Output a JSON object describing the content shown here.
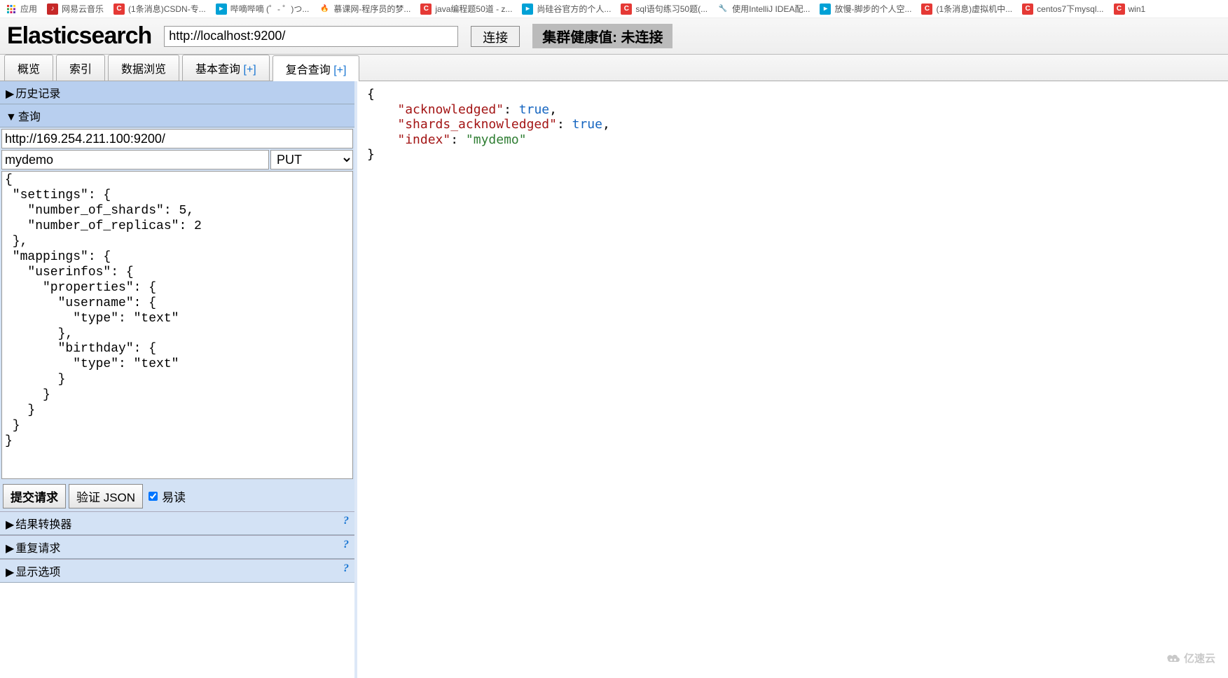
{
  "bookmarks": {
    "apps": "应用",
    "items": [
      {
        "label": "网易云音乐"
      },
      {
        "label": "(1条消息)CSDN-专..."
      },
      {
        "label": "哔嘀哔嘀 (゜- ゜)つ..."
      },
      {
        "label": "慕课网-程序员的梦..."
      },
      {
        "label": "java编程题50道 - z..."
      },
      {
        "label": "尚硅谷官方的个人..."
      },
      {
        "label": "sql语句练习50题(..."
      },
      {
        "label": "使用IntelliJ IDEA配..."
      },
      {
        "label": "放慢-脚步的个人空..."
      },
      {
        "label": "(1条消息)虚拟机中..."
      },
      {
        "label": "centos7下mysql..."
      },
      {
        "label": "win1"
      }
    ]
  },
  "header": {
    "logo": "Elasticsearch",
    "url": "http://localhost:9200/",
    "connect": "连接",
    "health": "集群健康值: 未连接"
  },
  "tabs": {
    "overview": "概览",
    "indices": "索引",
    "browse": "数据浏览",
    "basic": "基本查询",
    "compound": "复合查询",
    "plus": "[+]"
  },
  "left": {
    "history": "历史记录",
    "query": "查询",
    "query_url": "http://169.254.211.100:9200/",
    "index_name": "mydemo",
    "method": "PUT",
    "body": "{\n \"settings\": {\n   \"number_of_shards\": 5,\n   \"number_of_replicas\": 2\n },\n \"mappings\": {\n   \"userinfos\": {\n     \"properties\": {\n       \"username\": {\n         \"type\": \"text\"\n       },\n       \"birthday\": {\n         \"type\": \"text\"\n       }\n     }\n   }\n }\n}",
    "submit": "提交请求",
    "validate": "验证 JSON",
    "readable": "易读",
    "transformer": "结果转换器",
    "repeat": "重复请求",
    "display": "显示选项",
    "help": "?"
  },
  "response": {
    "k1": "\"acknowledged\"",
    "v1": "true",
    "k2": "\"shards_acknowledged\"",
    "v2": "true",
    "k3": "\"index\"",
    "v3": "\"mydemo\""
  },
  "watermark": "亿速云"
}
